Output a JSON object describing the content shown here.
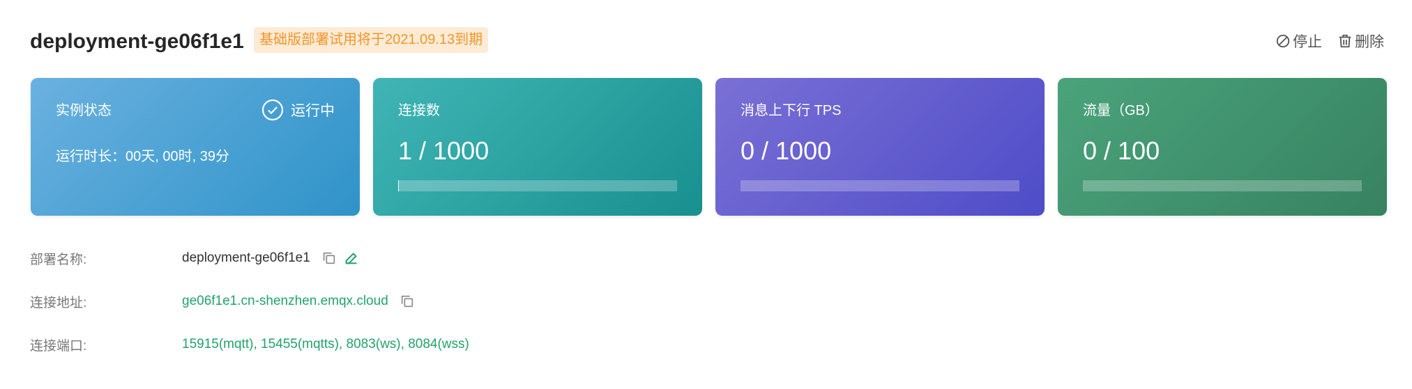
{
  "header": {
    "title": "deployment-ge06f1e1",
    "badge": "基础版部署试用将于2021.09.13到期",
    "stop_label": "停止",
    "delete_label": "删除"
  },
  "cards": {
    "status": {
      "label": "实例状态",
      "state": "运行中",
      "uptime": "运行时长：00天, 00时, 39分"
    },
    "connections": {
      "label": "连接数",
      "value": "1 / 1000",
      "progress": 0.001
    },
    "tps": {
      "label": "消息上下行 TPS",
      "value": "0 / 1000",
      "progress": 0
    },
    "traffic": {
      "label": "流量（GB）",
      "value": "0 / 100",
      "progress": 0
    }
  },
  "info": {
    "name": {
      "label": "部署名称:",
      "value": "deployment-ge06f1e1"
    },
    "address": {
      "label": "连接地址:",
      "value": "ge06f1e1.cn-shenzhen.emqx.cloud"
    },
    "ports": {
      "label": "连接端口:",
      "value": "15915(mqtt), 15455(mqtts), 8083(ws), 8084(wss)"
    }
  },
  "colors": {
    "accent_green": "#21a36a",
    "badge_text": "#f0962a",
    "badge_bg": "#fdebd6",
    "card_status": "#2f93c8",
    "card_connections": "#18908f",
    "card_tps": "#4e4cc8",
    "card_traffic": "#378261"
  }
}
